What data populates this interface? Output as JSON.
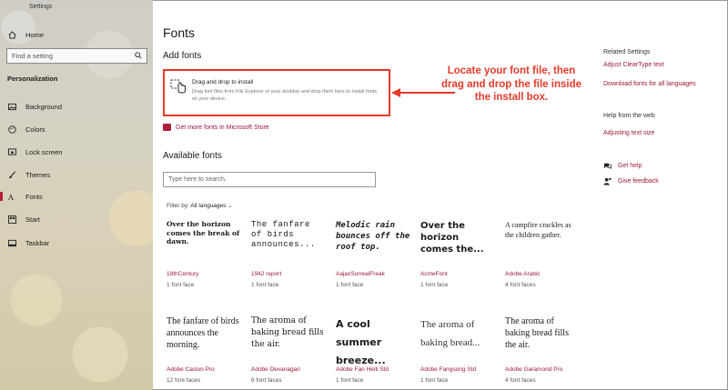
{
  "window": {
    "title": "Settings"
  },
  "sidebar": {
    "home_label": "Home",
    "search_placeholder": "Find a setting",
    "section_title": "Personalization",
    "items": [
      {
        "label": "Background",
        "icon": "image-icon"
      },
      {
        "label": "Colors",
        "icon": "palette-icon"
      },
      {
        "label": "Lock screen",
        "icon": "lock-screen-icon"
      },
      {
        "label": "Themes",
        "icon": "brush-icon"
      },
      {
        "label": "Fonts",
        "icon": "font-icon"
      },
      {
        "label": "Start",
        "icon": "start-icon"
      },
      {
        "label": "Taskbar",
        "icon": "taskbar-icon"
      }
    ],
    "active_item": "Fonts"
  },
  "main": {
    "page_title": "Fonts",
    "add_fonts_heading": "Add fonts",
    "drop_title": "Drag and drop to install",
    "drop_description": "Drag font files from File Explorer or your desktop and drop them here to install fonts on your device.",
    "store_link": "Get more fonts in Microsoft Store",
    "available_heading": "Available fonts",
    "search_placeholder": "Type here to search.",
    "filter_label": "Filter by:",
    "filter_value": "All languages",
    "fonts": [
      {
        "sample": "Over the horizon comes the break of dawn.",
        "name": "18thCentury",
        "faces": "1 font face"
      },
      {
        "sample": "The fanfare of birds announces...",
        "name": "1942 report",
        "faces": "1 font face"
      },
      {
        "sample": "Melodic rain bounces off the roof top.",
        "name": "AajaxSurrealFreak",
        "faces": "1 font face"
      },
      {
        "sample": "Over the horizon comes the...",
        "name": "AcmeFont",
        "faces": "1 font face"
      },
      {
        "sample": "A campfire crackles as the children gather.",
        "name": "Adobe Arabic",
        "faces": "4 font faces"
      },
      {
        "sample": "The fanfare of birds announces the morning.",
        "name": "Adobe Caslon Pro",
        "faces": "12 font faces"
      },
      {
        "sample": "The aroma of baking bread fills the air.",
        "name": "Adobe Devanagari",
        "faces": "6 font faces"
      },
      {
        "sample": "A cool summer breeze...",
        "name": "Adobe Fan Heiti Std",
        "faces": "1 font face"
      },
      {
        "sample": "The aroma of baking bread...",
        "name": "Adobe Fangsong Std",
        "faces": "1 font face"
      },
      {
        "sample": "The aroma of baking bread fills the air.",
        "name": "Adobe Garamond Pro",
        "faces": "4 font faces"
      }
    ]
  },
  "annotation": {
    "text": "Locate your font file, then drag and drop the file inside the install box.",
    "color": "#e53a2a"
  },
  "right_pane": {
    "related_heading": "Related Settings",
    "related_links": [
      "Adjust ClearType text",
      "Download fonts for all languages"
    ],
    "help_heading": "Help from the web",
    "help_links": [
      "Adjusting text size"
    ],
    "get_help": "Get help",
    "give_feedback": "Give feedback"
  },
  "colors": {
    "accent": "#9a1b34",
    "highlight_border": "#e53a2a"
  }
}
